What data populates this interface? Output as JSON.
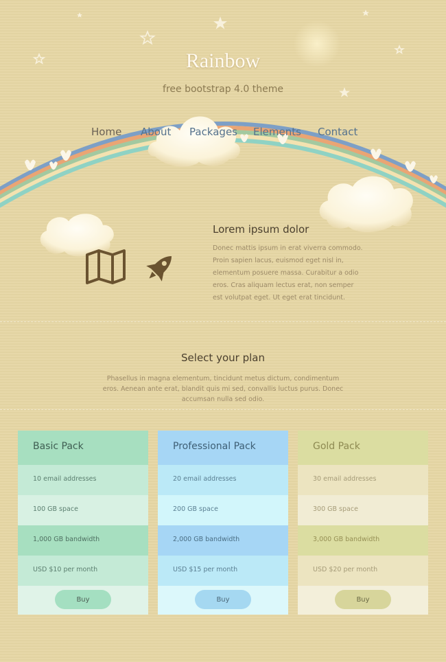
{
  "brand": {
    "logo": "Rainbow",
    "tagline": "free bootstrap 4.0 theme"
  },
  "nav": {
    "items": [
      {
        "label": "Home",
        "active": true
      },
      {
        "label": "About",
        "active": false
      },
      {
        "label": "Packages",
        "active": false
      },
      {
        "label": "Elements",
        "active": false
      },
      {
        "label": "Contact",
        "active": false
      }
    ]
  },
  "icons": [
    "map-icon",
    "rocket-icon",
    "moon-icon",
    "star-icon",
    "cloud-icon",
    "bird-icon",
    "rainbow"
  ],
  "about": {
    "heading": "Lorem ipsum dolor",
    "body": "Donec mattis ipsum in erat viverra commodo. Proin sapien lacus, euismod eget nisl in, elementum posuere massa. Curabitur a odio eros. Cras aliquam lectus erat, non semper est volutpat eget. Ut eget erat tincidunt."
  },
  "plans": {
    "title": "Select your plan",
    "description": "Phasellus in magna elementum, tincidunt metus dictum, condimentum eros. Aenean ante erat, blandit quis mi sed, convallis luctus purus. Donec accumsan nulla sed odio.",
    "cards": [
      {
        "name": "Basic Pack",
        "features": [
          "10 email addresses",
          "100 GB space",
          "1,000 GB bandwidth",
          "USD $10 per month"
        ],
        "button": "Buy"
      },
      {
        "name": "Professional Pack",
        "features": [
          "20 email addresses",
          "200 GB space",
          "2,000 GB bandwidth",
          "USD $15 per month"
        ],
        "button": "Buy"
      },
      {
        "name": "Gold Pack",
        "features": [
          "30 email addresses",
          "300 GB space",
          "3,000 GB bandwidth",
          "USD $20 per month"
        ],
        "button": "Buy"
      }
    ]
  },
  "colors": {
    "background": "#e6d6a4",
    "nav_link": "#55728d",
    "rainbow": [
      "#7d9fc6",
      "#eaa574",
      "#a3c9a0",
      "#f3e2b0",
      "#8fd2c4"
    ]
  }
}
